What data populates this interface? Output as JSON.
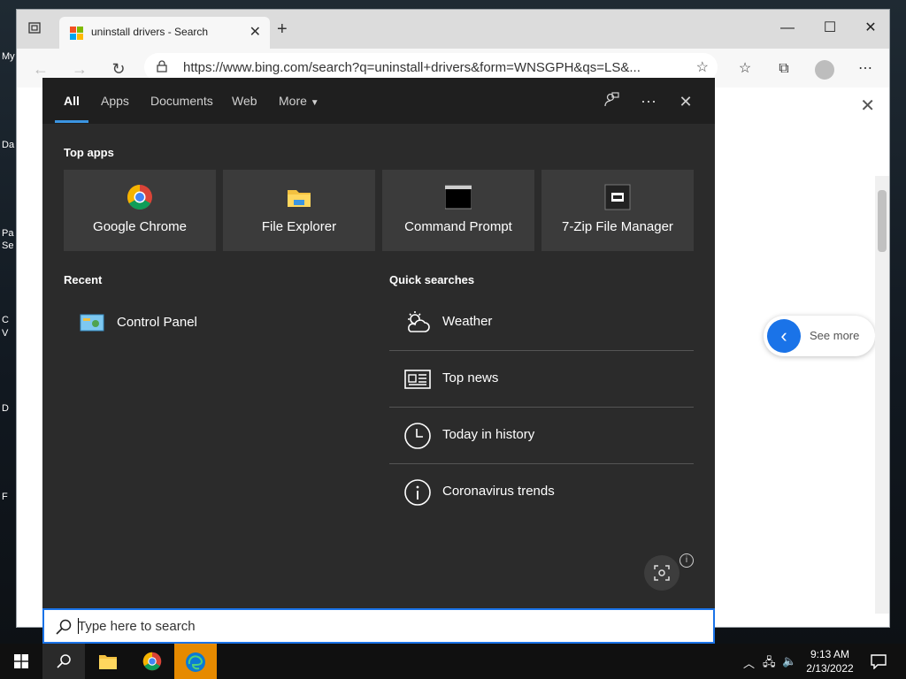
{
  "browser": {
    "tab_title": "uninstall drivers - Search",
    "url": "https://www.bing.com/search?q=uninstall+drivers&form=WNSGPH&qs=LS&...",
    "see_more": "See more"
  },
  "desktop_frags": [
    "My",
    "Da",
    "Pa",
    "Se",
    "C",
    "V",
    "D",
    "F"
  ],
  "search_panel": {
    "tabs": [
      "All",
      "Apps",
      "Documents",
      "Web",
      "More"
    ],
    "top_apps_title": "Top apps",
    "apps": [
      "Google Chrome",
      "File Explorer",
      "Command Prompt",
      "7-Zip File Manager"
    ],
    "recent_title": "Recent",
    "recent": [
      "Control Panel"
    ],
    "quick_title": "Quick searches",
    "quick": [
      "Weather",
      "Top news",
      "Today in history",
      "Coronavirus trends"
    ]
  },
  "searchbox": {
    "placeholder": "Type here to search"
  },
  "taskbar": {
    "time": "9:13 AM",
    "date": "2/13/2022"
  },
  "colors": {
    "accent": "#1a73e8",
    "panel_bg": "#2b2b2b",
    "edge_taskbar": "#e68a00"
  },
  "icons": [
    "collections-icon",
    "lock-icon",
    "favorite-add-icon",
    "windows-icon",
    "search-icon",
    "chrome-icon",
    "edge-icon",
    "file-explorer-icon",
    "command-prompt-icon",
    "7zip-icon",
    "control-panel-icon",
    "weather-icon",
    "news-icon",
    "clock-icon",
    "info-icon",
    "lens-icon",
    "feedback-icon",
    "notification-icon"
  ]
}
